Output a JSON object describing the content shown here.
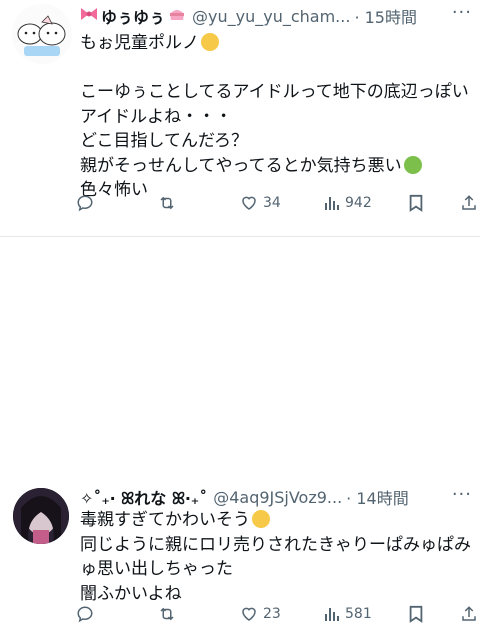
{
  "tweets": [
    {
      "name": "ゆぅゆぅ",
      "handle": "@yu_yu_yu_cham...",
      "time": "15時間",
      "more": "···",
      "lines": [
        "もぉ児童ポルノ",
        "",
        "こーゆぅことしてるアイドルって地下の底辺っぽい",
        "アイドルよね・・・",
        "どこ目指してんだろ？",
        "親がそっせんしてやってるとか気持ち悪い",
        "色々怖い"
      ],
      "emojis": [
        "angel-face",
        "nauseated-face"
      ],
      "stats": {
        "replies": "",
        "retweets": "",
        "likes": "34",
        "views": "942"
      }
    },
    {
      "name": "✧˚₊‧ ꕤれな ꕤ‧₊˚",
      "handle": "@4aq9JSjVoz9...",
      "time": "14時間",
      "more": "···",
      "lines": [
        "毒親すぎてかわいそう",
        "同じように親にロリ売りされたきゃりーぱみゅぱみ",
        "ゅ思い出しちゃった",
        "闇ふかいよね"
      ],
      "emojis": [
        "pleading-face"
      ],
      "stats": {
        "replies": "",
        "retweets": "",
        "likes": "23",
        "views": "581"
      }
    }
  ],
  "icons": {
    "reply": "reply-icon",
    "retweet": "retweet-icon",
    "like": "heart-icon",
    "views": "views-bar-icon",
    "bookmark": "bookmark-icon",
    "share": "share-icon"
  },
  "colors": {
    "text": "#0f1419",
    "secondary": "#536471",
    "divider": "#e6e9ec"
  }
}
